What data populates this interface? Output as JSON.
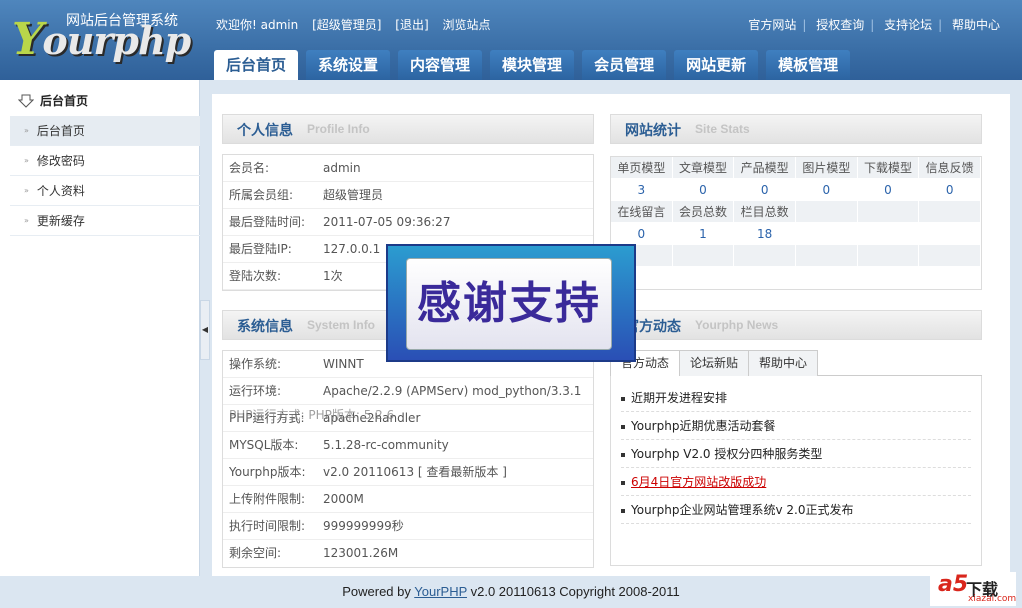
{
  "header": {
    "logo_subtitle": "网站后台管理系统",
    "logo_text": "ourphp",
    "logo_first": "Y",
    "welcome": "欢迎你! admin",
    "role_link": "[超级管理员]",
    "logout_link": "[退出]",
    "browse_link": "浏览站点",
    "top_links": [
      "官方网站",
      "授权查询",
      "支持论坛",
      "帮助中心"
    ],
    "tabs": [
      "后台首页",
      "系统设置",
      "内容管理",
      "模块管理",
      "会员管理",
      "网站更新",
      "模板管理"
    ]
  },
  "sidebar": {
    "title": "后台首页",
    "items": [
      "后台首页",
      "修改密码",
      "个人资料",
      "更新缓存"
    ]
  },
  "profile": {
    "title": "个人信息",
    "title_en": "Profile  Info",
    "rows": [
      {
        "k": "会员名:",
        "v": "admin"
      },
      {
        "k": "所属会员组:",
        "v": "超级管理员"
      },
      {
        "k": "最后登陆时间:",
        "v": "2011-07-05 09:36:27"
      },
      {
        "k": "最后登陆IP:",
        "v": "127.0.0.1"
      },
      {
        "k": "登陆次数:",
        "v": "1次"
      }
    ]
  },
  "sysinfo": {
    "title": "系统信息",
    "title_en": "System  Info",
    "rows": [
      {
        "k": "操作系统:",
        "v": "WINNT"
      },
      {
        "k": "运行环境:",
        "v": "Apache/2.2.9 (APMServ) mod_python/3.3.1"
      },
      {
        "k": "PHP运行方式:",
        "v": "apache2handler"
      },
      {
        "k": "MYSQL版本:",
        "v": "5.1.28-rc-community"
      },
      {
        "k": "Yourphp版本:",
        "v": "v2.0 20110613"
      },
      {
        "k": "上传附件限制:",
        "v": "2000M"
      },
      {
        "k": "执行时间限制:",
        "v": "999999999秒"
      },
      {
        "k": "剩余空间:",
        "v": "123001.26M"
      }
    ],
    "overlap_text": "PHP运行方式: PHP版本: 5.2.6",
    "version_link": "[ 查看最新版本 ]"
  },
  "stats": {
    "title": "网站统计",
    "title_en": "Site  Stats",
    "row1_heads": [
      "单页模型",
      "文章模型",
      "产品模型",
      "图片模型",
      "下载模型",
      "信息反馈"
    ],
    "row1_vals": [
      "3",
      "0",
      "0",
      "0",
      "0",
      "0"
    ],
    "row2_heads": [
      "在线留言",
      "会员总数",
      "栏目总数",
      "",
      "",
      ""
    ],
    "row2_vals": [
      "0",
      "1",
      "18",
      "",
      "",
      ""
    ]
  },
  "news": {
    "title": "官方动态",
    "title_en": "Yourphp  News",
    "tabs": [
      "官方动态",
      "论坛新贴",
      "帮助中心"
    ],
    "items": [
      "近期开发进程安排",
      "Yourphp近期优惠活动套餐",
      "Yourphp V2.0 授权分四种服务类型",
      "6月4日官方网站改版成功",
      "Yourphp企业网站管理系统v 2.0正式发布"
    ]
  },
  "overlay": {
    "text": "感谢支持"
  },
  "footer": {
    "prefix": "Powered by ",
    "link": "YourPHP",
    "suffix": " v2.0 20110613 Copyright 2008-2011"
  },
  "watermark": {
    "brand": "a5",
    "label": "下载",
    "domain": "xiazai.com"
  }
}
